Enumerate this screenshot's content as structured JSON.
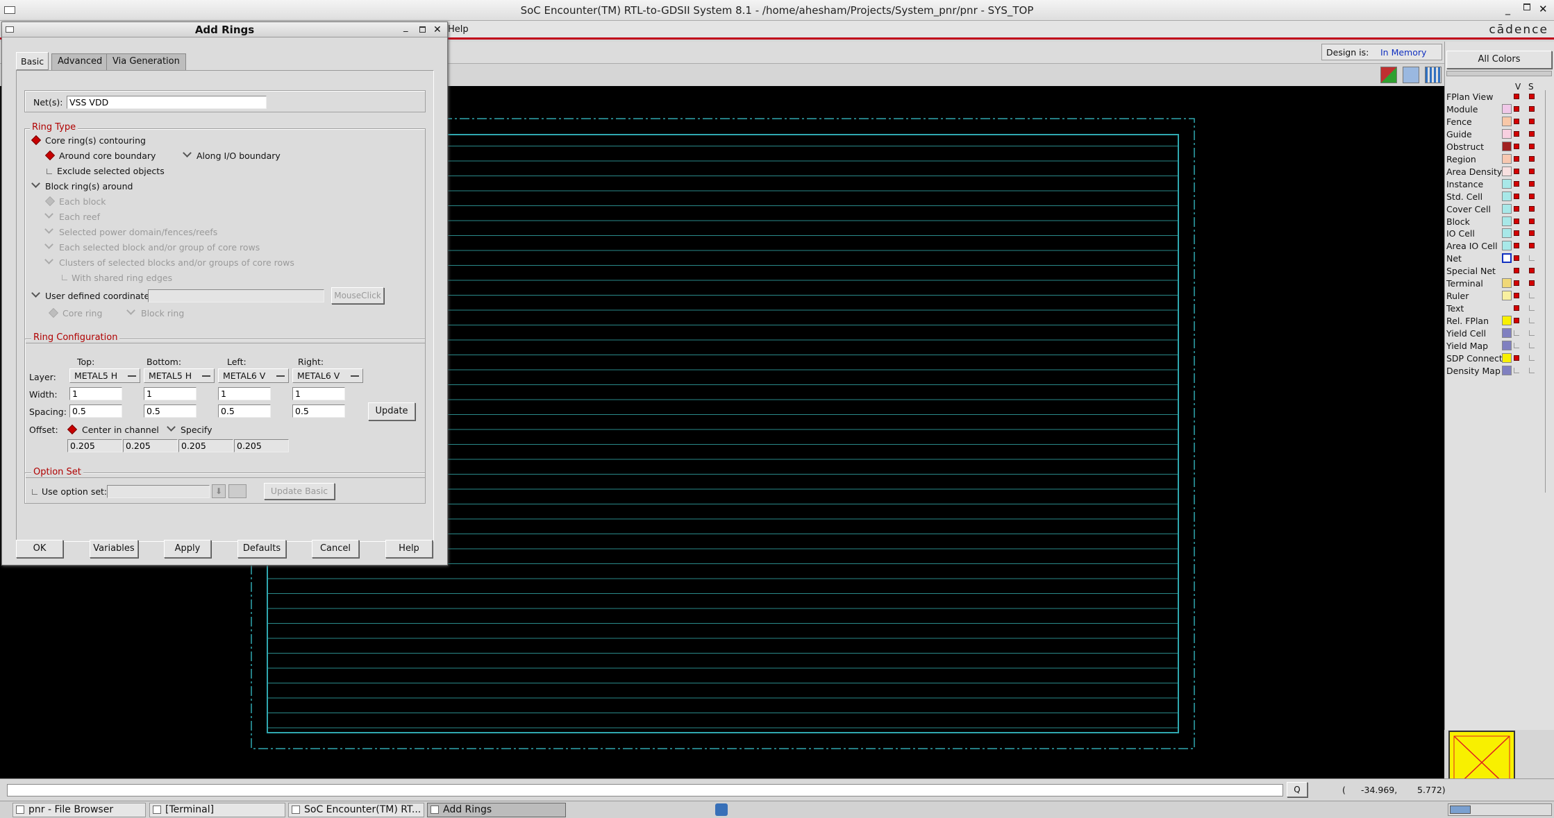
{
  "window": {
    "title": "SoC Encounter(TM) RTL-to-GDSII System 8.1 - /home/ahesham/Projects/System_pnr/pnr - SYS_TOP",
    "logo": "cādence",
    "menu_help": "Help"
  },
  "toolbar": {
    "design_is_label": "Design is:",
    "design_is_value": "In Memory",
    "all_colors": "All Colors"
  },
  "dialog": {
    "title": "Add Rings",
    "tabs": [
      "Basic",
      "Advanced",
      "Via Generation"
    ],
    "nets_label": "Net(s):",
    "nets_value": "VSS VDD",
    "ring_type": {
      "title": "Ring Type",
      "core_rings": "Core ring(s) contouring",
      "around_core": "Around core boundary",
      "along_io": "Along I/O boundary",
      "exclude_selected": "Exclude selected objects",
      "block_rings": "Block ring(s) around",
      "each_block": "Each block",
      "each_reef": "Each reef",
      "selected_power_domain": "Selected power domain/fences/reefs",
      "each_selected_block": "Each selected block and/or group of core rows",
      "clusters": "Clusters of selected blocks and/or groups of core rows",
      "with_shared": "With shared ring edges",
      "user_defined": "User defined coordinates:",
      "mouseclick": "MouseClick",
      "core_ring": "Core ring",
      "block_ring": "Block ring"
    },
    "ring_config": {
      "title": "Ring Configuration",
      "col_top": "Top:",
      "col_bottom": "Bottom:",
      "col_left": "Left:",
      "col_right": "Right:",
      "layer_label": "Layer:",
      "layers": [
        "METAL5 H",
        "METAL5 H",
        "METAL6 V",
        "METAL6 V"
      ],
      "width_label": "Width:",
      "widths": [
        "1",
        "1",
        "1",
        "1"
      ],
      "spacing_label": "Spacing:",
      "spacings": [
        "0.5",
        "0.5",
        "0.5",
        "0.5"
      ],
      "update": "Update",
      "offset_label": "Offset:",
      "center_in_channel": "Center in channel",
      "specify": "Specify",
      "offsets": [
        "0.205",
        "0.205",
        "0.205",
        "0.205"
      ]
    },
    "option_set": {
      "title": "Option Set",
      "use_option_set": "Use option set:",
      "update_basic": "Update Basic"
    },
    "buttons": [
      "OK",
      "Variables",
      "Apply",
      "Defaults",
      "Cancel",
      "Help"
    ]
  },
  "legend": {
    "header_v": "V",
    "header_s": "S",
    "items": [
      {
        "label": "FPlan View",
        "color": "",
        "v": true,
        "s": true
      },
      {
        "label": "Module",
        "color": "#f0c8e8",
        "v": true,
        "s": true
      },
      {
        "label": "Fence",
        "color": "#f8c8a8",
        "v": true,
        "s": true
      },
      {
        "label": "Guide",
        "color": "#f8d0e0",
        "v": true,
        "s": true
      },
      {
        "label": "Obstruct",
        "color": "#a02020",
        "v": true,
        "s": true
      },
      {
        "label": "Region",
        "color": "#f8c8b0",
        "v": true,
        "s": true
      },
      {
        "label": "Area Density",
        "color": "#f8e0e0",
        "v": true,
        "s": true
      },
      {
        "label": "Instance",
        "color": "#a8e8e8",
        "v": true,
        "s": true
      },
      {
        "label": "Std. Cell",
        "color": "#a8e8e8",
        "v": true,
        "s": true
      },
      {
        "label": "Cover Cell",
        "color": "#a8e8e8",
        "v": true,
        "s": true
      },
      {
        "label": "Block",
        "color": "#a8e8e8",
        "v": true,
        "s": true
      },
      {
        "label": "IO Cell",
        "color": "#a8e8e8",
        "v": true,
        "s": true
      },
      {
        "label": "Area IO Cell",
        "color": "#a8e8e8",
        "v": true,
        "s": true
      },
      {
        "label": "Net",
        "color": "#1030c0",
        "v": true,
        "s": false
      },
      {
        "label": "Special Net",
        "color": "",
        "v": true,
        "s": true
      },
      {
        "label": "Terminal",
        "color": "#f0d878",
        "v": true,
        "s": true
      },
      {
        "label": "Ruler",
        "color": "#f8f0a0",
        "v": true,
        "s": false
      },
      {
        "label": "Text",
        "color": "",
        "v": true,
        "s": false
      },
      {
        "label": "Rel. FPlan",
        "color": "#f8f000",
        "v": true,
        "s": false
      },
      {
        "label": "Yield Cell",
        "color": "#8080c0",
        "v": false,
        "s": false
      },
      {
        "label": "Yield Map",
        "color": "#8080c0",
        "v": false,
        "s": false
      },
      {
        "label": "SDP Connect",
        "color": "#f8f000",
        "v": true,
        "s": false
      },
      {
        "label": "Density Map",
        "color": "#8080c0",
        "v": false,
        "s": false
      }
    ]
  },
  "status": {
    "query_btn": "Q",
    "coord_open": "(",
    "coord_x": "-34.969,",
    "coord_y": "5.772)"
  },
  "taskbar": [
    "pnr - File Browser",
    "[Terminal]",
    "SoC Encounter(TM) RT...",
    "Add Rings"
  ]
}
